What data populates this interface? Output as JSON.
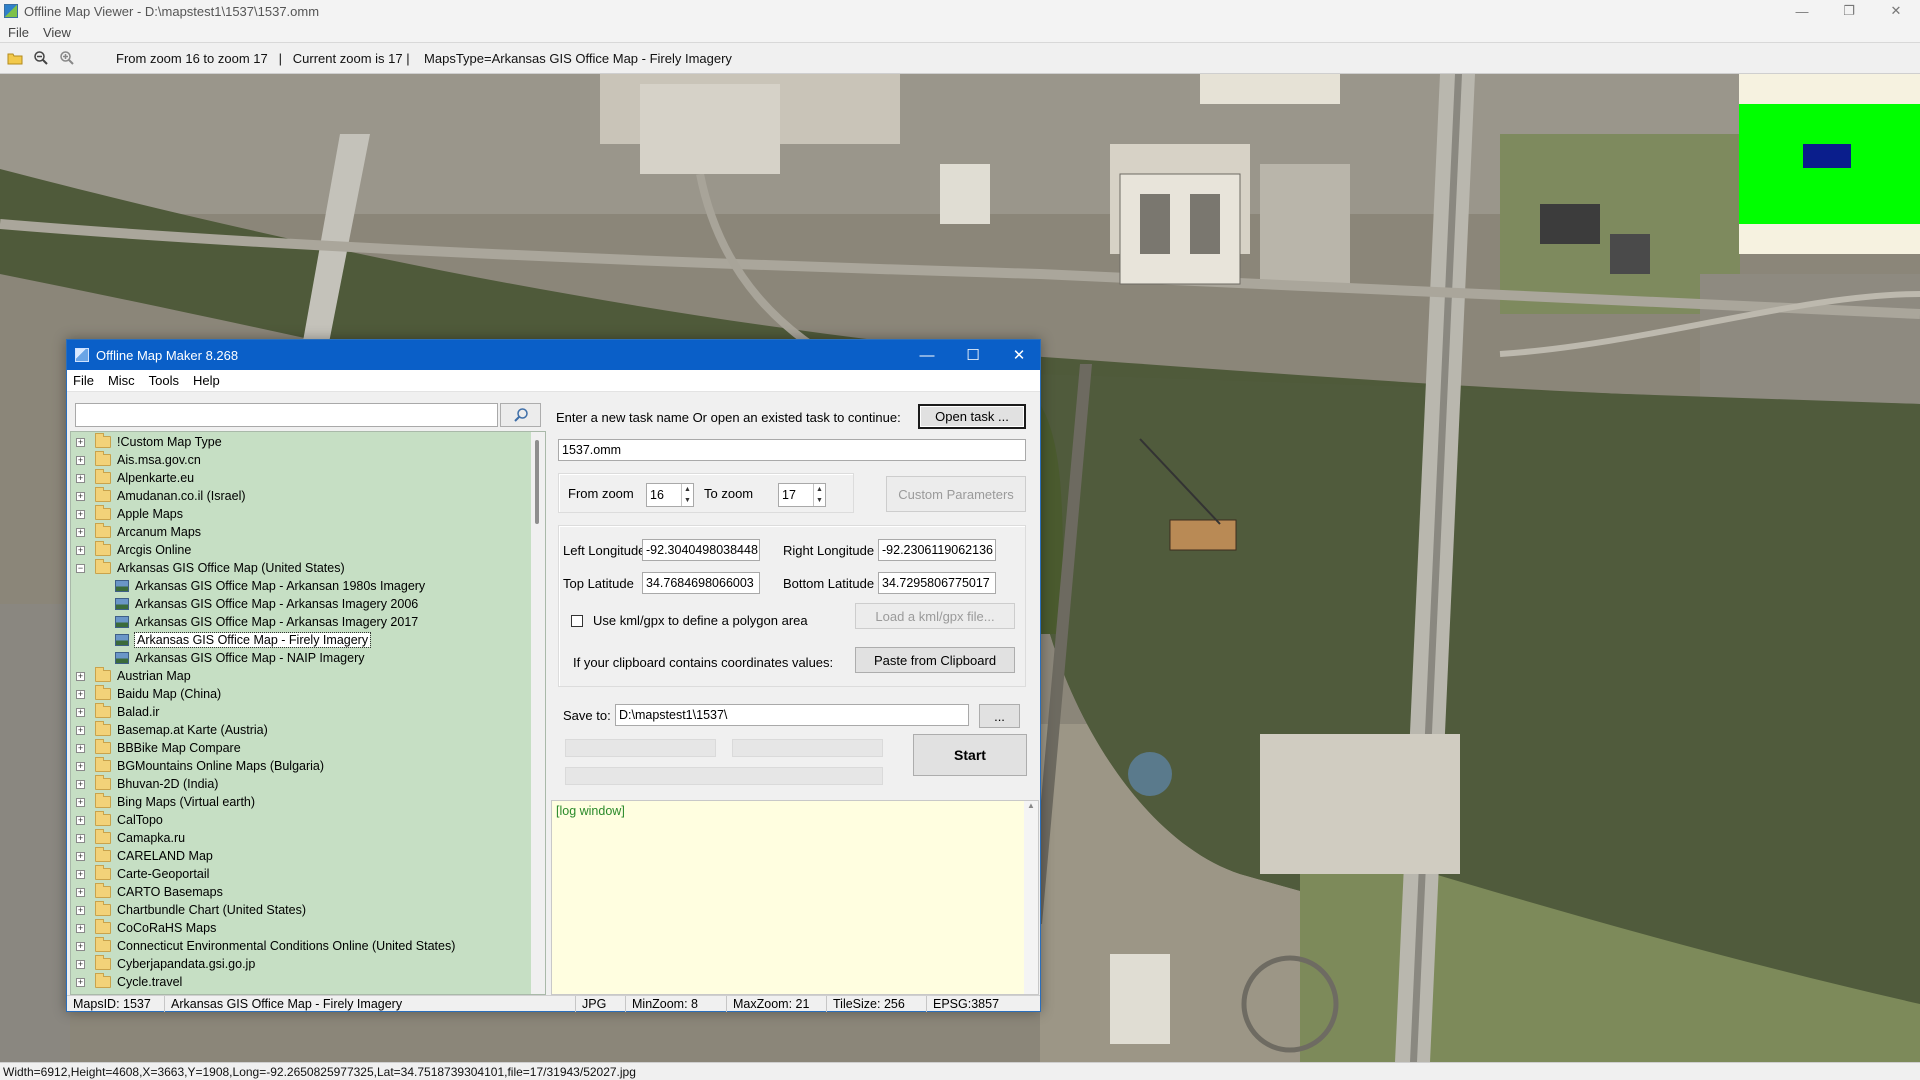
{
  "window": {
    "title": "Offline Map Viewer - D:\\mapstest1\\1537\\1537.omm",
    "menu": [
      "File",
      "View"
    ],
    "controls": {
      "minimize": "—",
      "restore": "❐",
      "close": "✕"
    }
  },
  "toolbar": {
    "info": "From zoom 16 to zoom 17   |   Current zoom is 17 |    MapsType=Arkansas GIS Office Map - Firely Imagery",
    "icons": [
      "open-folder-icon",
      "zoom-out-icon",
      "zoom-in-icon"
    ]
  },
  "statusbar": {
    "text": "Width=6912,Height=4608,X=3663,Y=1908,Long=-92.2650825977325,Lat=34.7518739304101,file=17/31943/52027.jpg"
  },
  "dialog": {
    "title": "Offline Map Maker 8.268",
    "menu": [
      "File",
      "Misc",
      "Tools",
      "Help"
    ],
    "controls": {
      "minimize": "—",
      "maximize": "☐",
      "close": "✕"
    },
    "search": {
      "value": "",
      "placeholder": ""
    },
    "tree": [
      {
        "label": "!Custom Map Type",
        "type": "folder"
      },
      {
        "label": "Ais.msa.gov.cn",
        "type": "folder"
      },
      {
        "label": "Alpenkarte.eu",
        "type": "folder"
      },
      {
        "label": "Amudanan.co.il (Israel)",
        "type": "folder"
      },
      {
        "label": "Apple Maps",
        "type": "folder"
      },
      {
        "label": "Arcanum Maps",
        "type": "folder"
      },
      {
        "label": "Arcgis Online",
        "type": "folder"
      },
      {
        "label": "Arkansas GIS Office Map (United States)",
        "type": "folder-open"
      },
      {
        "label": "Arkansas GIS Office Map - Arkansan 1980s Imagery",
        "type": "leaf"
      },
      {
        "label": "Arkansas GIS Office Map - Arkansas Imagery 2006",
        "type": "leaf"
      },
      {
        "label": "Arkansas GIS Office Map - Arkansas Imagery 2017",
        "type": "leaf"
      },
      {
        "label": "Arkansas GIS Office Map - Firely Imagery",
        "type": "leaf",
        "selected": true
      },
      {
        "label": "Arkansas GIS Office Map - NAIP Imagery",
        "type": "leaf"
      },
      {
        "label": "Austrian Map",
        "type": "folder"
      },
      {
        "label": "Baidu Map (China)",
        "type": "folder"
      },
      {
        "label": "Balad.ir",
        "type": "folder"
      },
      {
        "label": "Basemap.at Karte (Austria)",
        "type": "folder"
      },
      {
        "label": "BBBike Map Compare",
        "type": "folder"
      },
      {
        "label": "BGMountains Online Maps (Bulgaria)",
        "type": "folder"
      },
      {
        "label": "Bhuvan-2D (India)",
        "type": "folder"
      },
      {
        "label": "Bing Maps (Virtual earth)",
        "type": "folder"
      },
      {
        "label": "CalTopo",
        "type": "folder"
      },
      {
        "label": "Camapka.ru",
        "type": "folder"
      },
      {
        "label": "CARELAND Map",
        "type": "folder"
      },
      {
        "label": "Carte-Geoportail",
        "type": "folder"
      },
      {
        "label": "CARTO Basemaps",
        "type": "folder"
      },
      {
        "label": "Chartbundle Chart (United States)",
        "type": "folder"
      },
      {
        "label": "CoCoRaHS Maps",
        "type": "folder"
      },
      {
        "label": "Connecticut Environmental Conditions Online (United States)",
        "type": "folder"
      },
      {
        "label": "Cyberjapandata.gsi.go.jp",
        "type": "folder"
      },
      {
        "label": "Cycle.travel",
        "type": "folder"
      }
    ],
    "task": {
      "prompt": "Enter a new task name Or open an existed task to continue:",
      "open_button": "Open task ...",
      "name": "1537.omm"
    },
    "zoom": {
      "from_label": "From zoom",
      "from_value": "16",
      "to_label": "To zoom",
      "to_value": "17",
      "custom_button": "Custom Parameters"
    },
    "coords": {
      "left_lon_label": "Left Longitude",
      "left_lon": "-92.3040498038448",
      "right_lon_label": "Right Longitude",
      "right_lon": "-92.2306119062136",
      "top_lat_label": "Top Latitude",
      "top_lat": "34.7684698066003",
      "bottom_lat_label": "Bottom Latitude",
      "bottom_lat": "34.7295806775017",
      "kml_label": "Use kml/gpx to define a polygon area",
      "kml_button": "Load a kml/gpx file...",
      "clipboard_label": "If your clipboard contains coordinates values:",
      "clipboard_button": "Paste from Clipboard"
    },
    "save": {
      "label": "Save to:",
      "path": "D:\\mapstest1\\1537\\",
      "browse": "..."
    },
    "start_button": "Start",
    "log": "[log window]",
    "status": {
      "maps_id": "MapsID: 1537",
      "map_name": "Arkansas GIS Office Map - Firely Imagery",
      "format": "JPG",
      "min_zoom": "MinZoom: 8",
      "max_zoom": "MaxZoom: 21",
      "tile_size": "TileSize: 256",
      "epsg": "EPSG:3857"
    }
  },
  "colors": {
    "dialog_title": "#0a5fc8",
    "tree_bg": "#c6dfc4",
    "log_bg": "#fffee0",
    "minimap_green": "#00ff00",
    "minimap_view": "#0a1e8c",
    "river": "#4f5a3a"
  }
}
